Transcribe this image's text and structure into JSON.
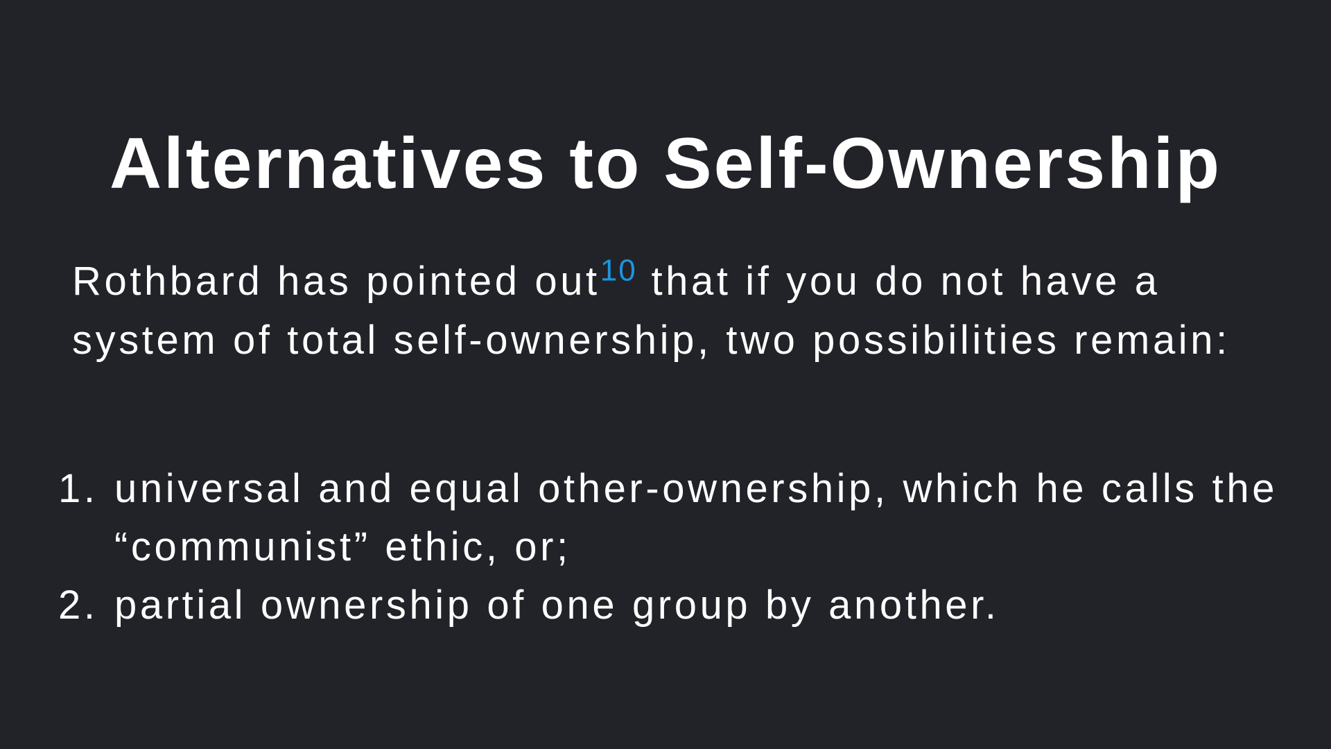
{
  "slide": {
    "title": "Alternatives to Self-Ownership",
    "intro": {
      "before": "Rothbard has pointed out",
      "footnote": "10",
      "after": " that if you do not have a system of total self-ownership, two possibilities remain:"
    },
    "items": [
      {
        "number": "1.",
        "text": "universal and equal other-ownership, which he calls the “communist” ethic, or;"
      },
      {
        "number": "2.",
        "text": "partial ownership of one group by another."
      }
    ],
    "colors": {
      "background": "#222328",
      "text": "#ffffff",
      "footnote_link": "#1c95e0"
    }
  }
}
